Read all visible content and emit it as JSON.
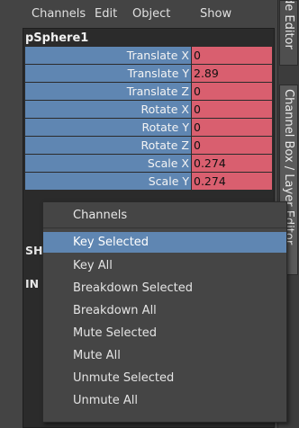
{
  "menubar": {
    "items": [
      "Channels",
      "Edit",
      "Object",
      "Show"
    ]
  },
  "channel_box": {
    "object_name": "pSphere1",
    "attributes": [
      {
        "name": "Translate X",
        "value": "0"
      },
      {
        "name": "Translate Y",
        "value": "2.89"
      },
      {
        "name": "Translate Z",
        "value": "0"
      },
      {
        "name": "Rotate X",
        "value": "0"
      },
      {
        "name": "Rotate Y",
        "value": "0"
      },
      {
        "name": "Rotate Z",
        "value": "0"
      },
      {
        "name": "Scale X",
        "value": "0.274"
      },
      {
        "name": "Scale Y",
        "value": "0.274"
      }
    ],
    "partial_labels": [
      "SH",
      "IN"
    ]
  },
  "right_tabs": {
    "top_tab": "de Editor",
    "main_tab": "Channel Box / Layer Editor"
  },
  "context_menu": {
    "header": "Channels",
    "options": [
      "Key Selected",
      "Key All",
      "Breakdown Selected",
      "Breakdown All",
      "Mute Selected",
      "Mute All",
      "Unmute Selected",
      "Unmute All"
    ],
    "highlighted": "Key Selected"
  }
}
